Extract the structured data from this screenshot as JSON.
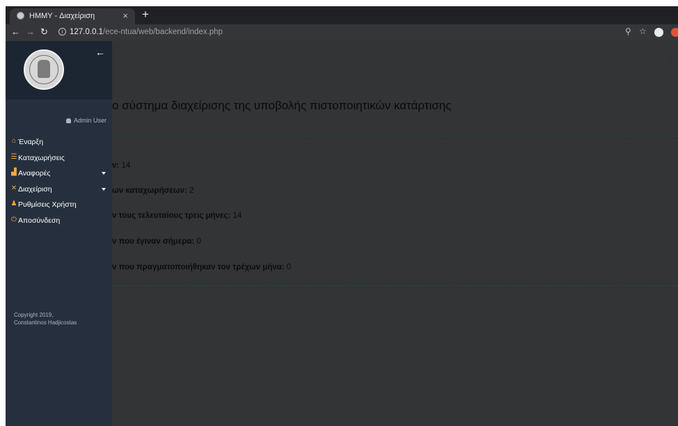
{
  "browser": {
    "tab_title": "HMMY - Διαχείριση",
    "tab_close": "×",
    "new_tab": "+",
    "url_host": "127.0.0.1",
    "url_path": "/ece-ntua/web/backend/index.php",
    "icons": [
      "back-icon",
      "forward-icon",
      "reload-icon",
      "info-icon",
      "zoom-icon",
      "star-icon",
      "profile-icon",
      "extension-icon"
    ]
  },
  "sidebar": {
    "user": "Admin User",
    "items": [
      {
        "label": "Έναρξη",
        "icon": "home-icon",
        "color": "#f0a93b",
        "caret": false
      },
      {
        "label": "Καταχωρήσεις",
        "icon": "list-icon",
        "color": "#f0a93b",
        "caret": false
      },
      {
        "label": "Αναφορές",
        "icon": "chart-icon",
        "color": "#f0a93b",
        "caret": true
      },
      {
        "label": "Διαχείριση",
        "icon": "tools-icon",
        "color": "#f0a93b",
        "caret": true
      },
      {
        "label": "Ρυθμίσεις Χρήστη",
        "icon": "user-cog-icon",
        "color": "#f0a93b",
        "caret": false
      },
      {
        "label": "Αποσύνδεση",
        "icon": "power-icon",
        "color": "#f0a93b",
        "caret": false
      }
    ],
    "copyright_line1": "Copyright 2019,",
    "copyright_line2": "Constantinos Hadjicostas"
  },
  "main": {
    "heading": "ο σύστημα διαχείρισης της υποβολής πιστοποιητικών κατάρτισης",
    "stats": [
      {
        "label": "ν:",
        "value": "14"
      },
      {
        "label": "ων καταχωρήσεων:",
        "value": "2"
      },
      {
        "label": "ν τους τελευταίους τρεις μήνες:",
        "value": "14"
      },
      {
        "label": "ν που έγιναν σήμερα:",
        "value": "0"
      },
      {
        "label": "ν που πραγματοποιήθηκαν τον τρέχων μήνα:",
        "value": "0"
      }
    ]
  }
}
